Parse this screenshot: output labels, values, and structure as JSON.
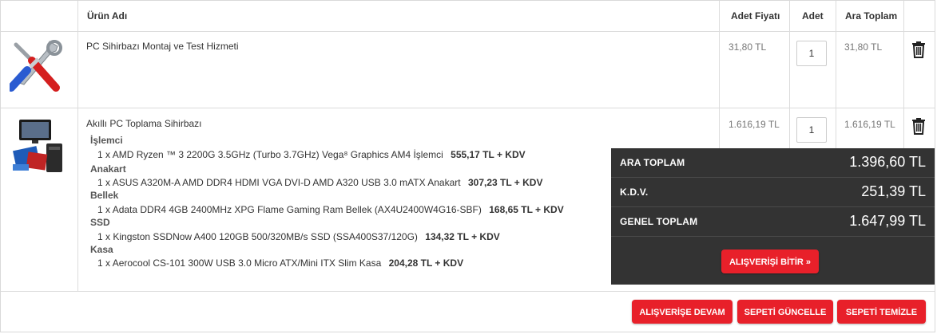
{
  "table": {
    "headers": {
      "name": "Ürün Adı",
      "unit_price": "Adet Fiyatı",
      "qty": "Adet",
      "subtotal": "Ara Toplam"
    }
  },
  "items": [
    {
      "name": "PC Sihirbazı Montaj ve Test Hizmeti",
      "unit_price": "31,80 TL",
      "qty": "1",
      "subtotal": "31,80 TL",
      "image_icon": "tools-icon"
    },
    {
      "name": "Akıllı PC Toplama Sihirbazı",
      "unit_price": "1.616,19 TL",
      "qty": "1",
      "subtotal": "1.616,19 TL",
      "image_icon": "pc-bundle-icon",
      "components": [
        {
          "category": "İşlemci",
          "qty_label": "1 x",
          "name": "AMD Ryzen ™ 3 2200G 3.5GHz (Turbo 3.7GHz) Vega⁸ Graphics AM4 İşlemci",
          "price": "555,17 TL + KDV"
        },
        {
          "category": "Anakart",
          "qty_label": "1 x",
          "name": "ASUS A320M-A AMD DDR4 HDMI VGA DVI-D AMD A320 USB 3.0 mATX Anakart",
          "price": "307,23 TL + KDV"
        },
        {
          "category": "Bellek",
          "qty_label": "1 x",
          "name": "Adata DDR4 4GB 2400MHz XPG Flame Gaming Ram Bellek (AX4U2400W4G16-SBF)",
          "price": "168,65 TL + KDV"
        },
        {
          "category": "SSD",
          "qty_label": "1 x",
          "name": "Kingston SSDNow A400 120GB 500/320MB/s SSD (SSA400S37/120G)",
          "price": "134,32 TL + KDV"
        },
        {
          "category": "Kasa",
          "qty_label": "1 x",
          "name": "Aerocool CS-101 300W USB 3.0 Micro ATX/Mini ITX Slim Kasa",
          "price": "204,28 TL + KDV"
        }
      ]
    }
  ],
  "summary": {
    "subtotal_label": "ARA TOPLAM",
    "subtotal_value": "1.396,60 TL",
    "tax_label": "K.D.V.",
    "tax_value": "251,39 TL",
    "total_label": "GENEL TOPLAM",
    "total_value": "1.647,99 TL",
    "checkout_label": "ALIŞVERİŞİ BİTİR »"
  },
  "actions": {
    "continue_label": "ALIŞVERİŞE DEVAM",
    "update_label": "SEPETİ GÜNCELLE",
    "clear_label": "SEPETİ TEMİZLE"
  },
  "colors": {
    "accent": "#e8202a",
    "summary_bg": "#333333"
  },
  "icons": {
    "delete": "trash-icon"
  }
}
